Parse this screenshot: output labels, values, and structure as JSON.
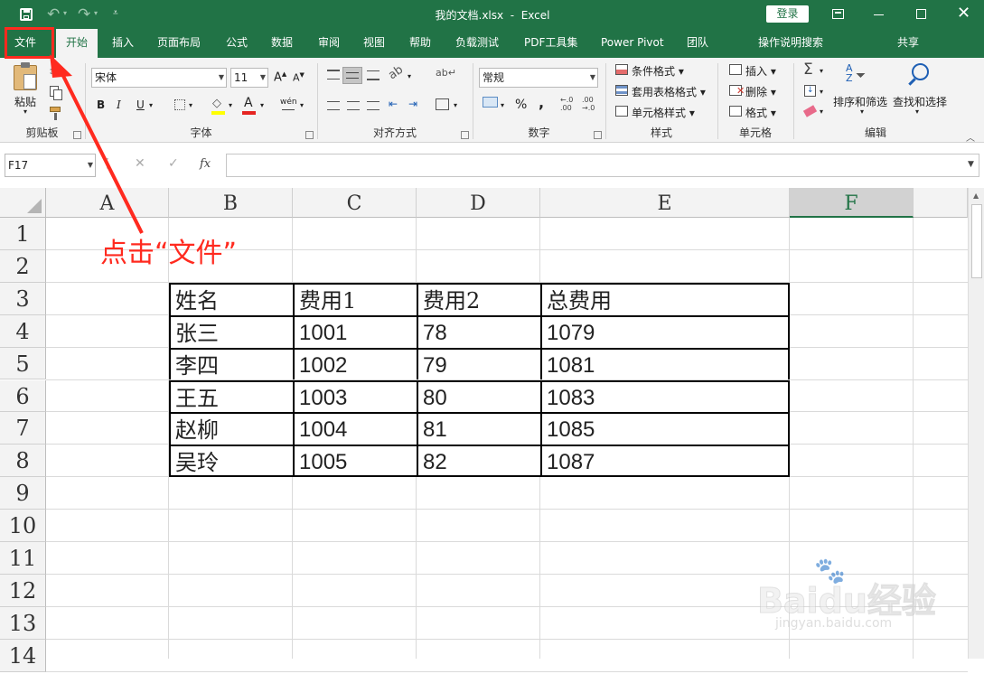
{
  "window": {
    "title": "我的文档.xlsx  -  Excel",
    "login_label": "登录"
  },
  "qat": {
    "save_icon": "save-icon",
    "undo_icon": "undo-icon",
    "redo_icon": "redo-icon",
    "customize_icon": "customize-icon"
  },
  "tabs": [
    "文件",
    "开始",
    "插入",
    "页面布局",
    "公式",
    "数据",
    "审阅",
    "视图",
    "帮助",
    "负载测试",
    "PDF工具集",
    "Power Pivot",
    "团队",
    "操作说明搜索"
  ],
  "share_label": "共享",
  "ribbon": {
    "clipboard": {
      "paste": "粘贴",
      "label": "剪贴板"
    },
    "font": {
      "name": "宋体",
      "size": "11",
      "label": "字体",
      "bold": "B",
      "italic": "I",
      "underline": "U",
      "phonetic": "wén"
    },
    "alignment": {
      "label": "对齐方式"
    },
    "number": {
      "format": "常规",
      "label": "数字",
      "percent": "%",
      "comma": ","
    },
    "styles": {
      "conditional": "条件格式",
      "table": "套用表格格式",
      "cell": "单元格样式",
      "label": "样式"
    },
    "cells": {
      "insert": "插入",
      "delete": "删除",
      "format": "格式",
      "label": "单元格"
    },
    "editing": {
      "sort": "排序和筛选",
      "find": "查找和选择",
      "label": "编辑"
    }
  },
  "formula_bar": {
    "name_box": "F17",
    "cancel": "✕",
    "enter": "✓",
    "fx": "fx",
    "value": ""
  },
  "sheet": {
    "columns": [
      "A",
      "B",
      "C",
      "D",
      "E",
      "F"
    ],
    "rows": [
      "1",
      "2",
      "3",
      "4",
      "5",
      "6",
      "7",
      "8",
      "9",
      "10",
      "11",
      "12",
      "13",
      "14"
    ],
    "table": [
      [
        "姓名",
        "费用1",
        "费用2",
        "总费用"
      ],
      [
        "张三",
        "1001",
        "78",
        "1079"
      ],
      [
        "李四",
        "1002",
        "79",
        "1081"
      ],
      [
        "王五",
        "1003",
        "80",
        "1083"
      ],
      [
        "赵柳",
        "1004",
        "81",
        "1085"
      ],
      [
        "吴玲",
        "1005",
        "82",
        "1087"
      ]
    ]
  },
  "annotation": {
    "text": "点击“文件”",
    "color": "#ff2a1f"
  },
  "watermark": {
    "brand": "Baidu经验",
    "url": "jingyan.baidu.com"
  },
  "colors": {
    "accent": "#217346"
  }
}
